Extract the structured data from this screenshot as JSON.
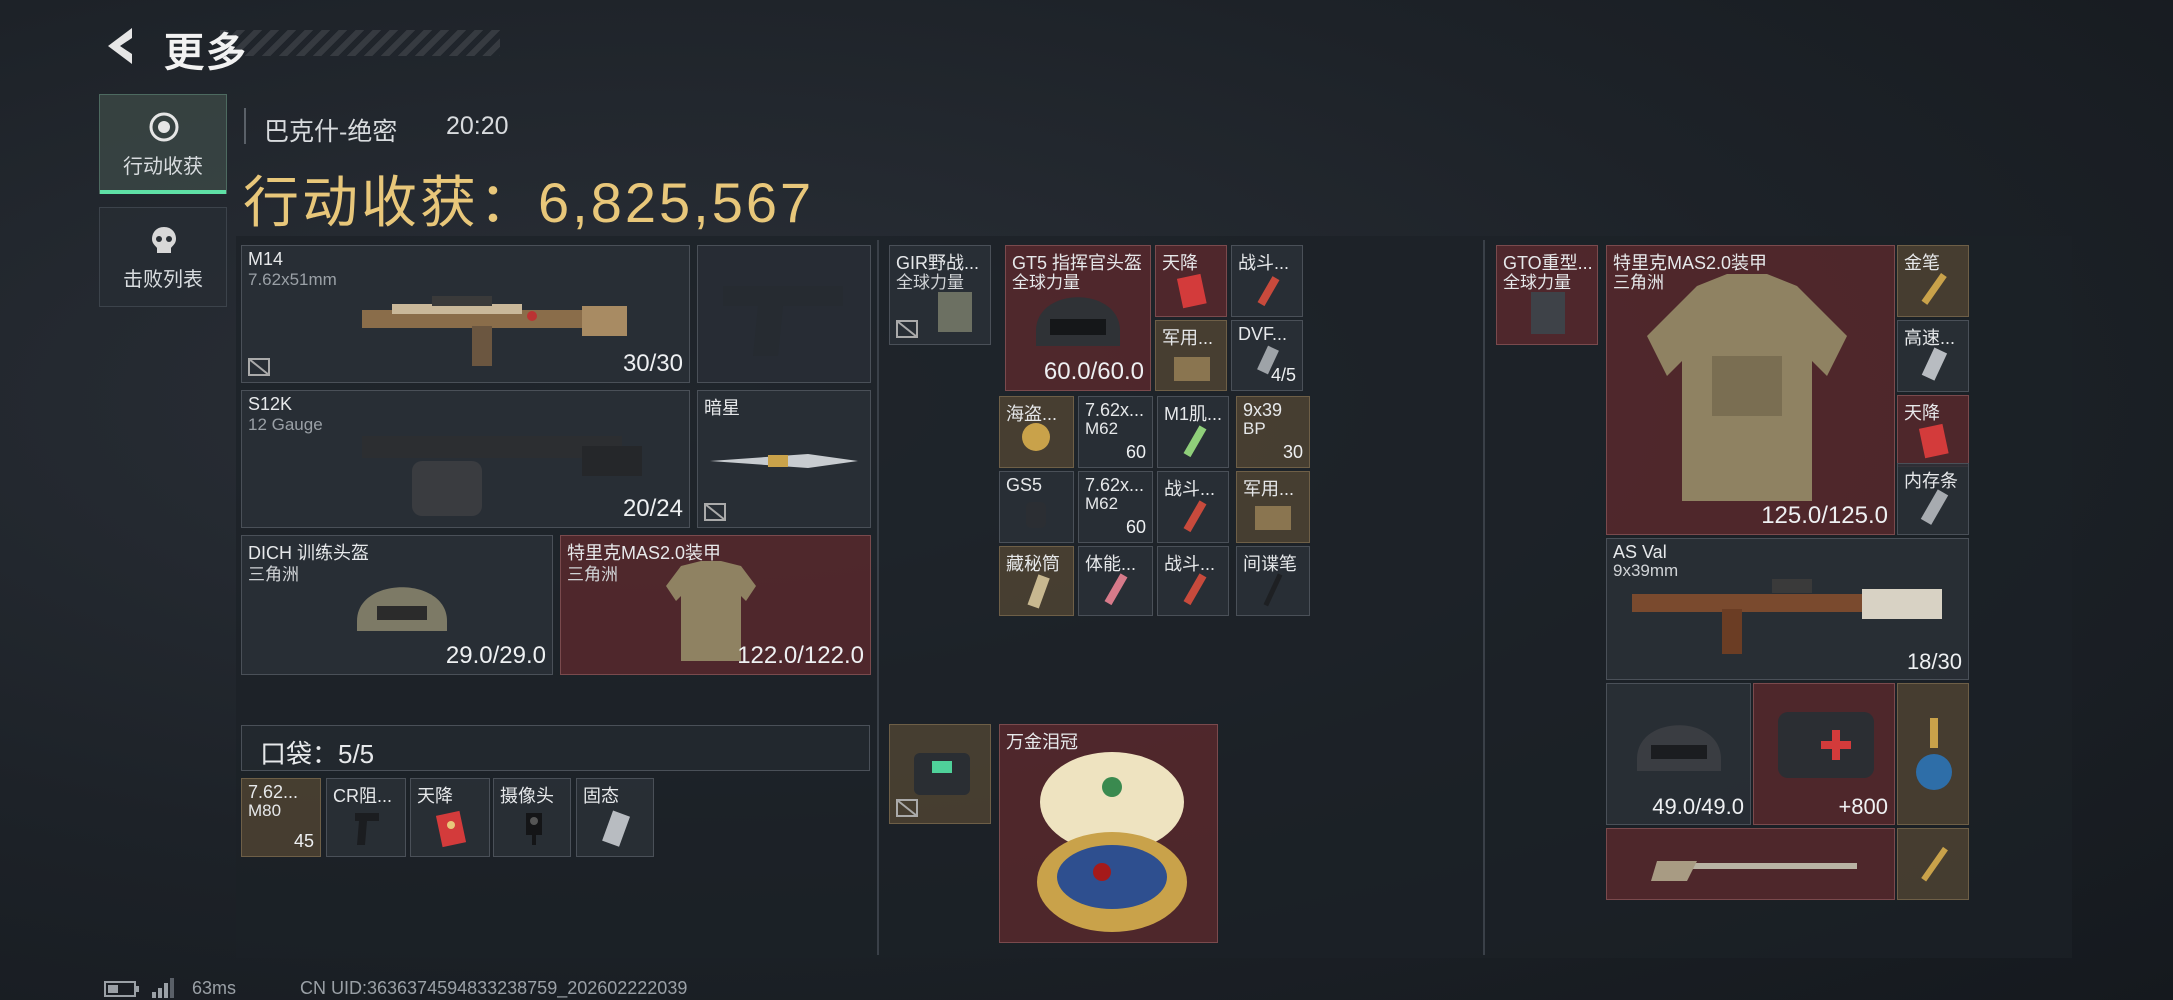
{
  "header": {
    "title": "更多"
  },
  "tabs": [
    {
      "label": "行动收获",
      "active": true
    },
    {
      "label": "击败列表",
      "active": false
    }
  ],
  "operation": {
    "map": "巴克什-绝密",
    "time": "20:20",
    "loot_label": "行动收获：6,825,567"
  },
  "loadout": {
    "primary": {
      "name": "M14",
      "caliber": "7.62x51mm",
      "ammo": "30/30"
    },
    "secondary": {
      "name": "S12K",
      "caliber": "12 Gauge",
      "ammo": "20/24"
    },
    "melee": {
      "name": "暗星"
    },
    "helmet": {
      "name": "DICH 训练头盔",
      "origin": "三角洲",
      "durability": "29.0/29.0"
    },
    "armor": {
      "name": "特里克MAS2.0装甲",
      "origin": "三角洲",
      "durability": "122.0/122.0"
    },
    "pocket": {
      "label": "口袋：5/5",
      "items": [
        {
          "name": "7.62...",
          "sub": "M80",
          "count": "45"
        },
        {
          "name": "CR阻..."
        },
        {
          "name": "天降"
        },
        {
          "name": "摄像头"
        },
        {
          "name": "固态"
        }
      ]
    }
  },
  "middle": {
    "rig": {
      "name": "GIR野战...",
      "origin": "全球力量"
    },
    "helmet": {
      "name": "GT5 指挥官头盔",
      "origin": "全球力量",
      "durability": "60.0/60.0"
    },
    "rig_items": [
      {
        "name": "天降"
      },
      {
        "name": "战斗..."
      },
      {
        "name": "军用..."
      },
      {
        "name": "DVF...",
        "count": "4/5"
      }
    ],
    "backpack_items": [
      {
        "name": "海盗..."
      },
      {
        "name": "7.62x...",
        "sub": "M62",
        "count": "60"
      },
      {
        "name": "M1肌..."
      },
      {
        "name": "9x39",
        "sub": "BP",
        "count": "30"
      },
      {
        "name": "GS5"
      },
      {
        "name": "7.62x...",
        "sub": "M62",
        "count": "60"
      },
      {
        "name": "战斗..."
      },
      {
        "name": "军用..."
      },
      {
        "name": "藏秘筒"
      },
      {
        "name": "体能..."
      },
      {
        "name": "战斗..."
      },
      {
        "name": "间谍笔"
      }
    ],
    "safe_box": {
      "name": ""
    },
    "treasure": {
      "name": "万金泪冠"
    }
  },
  "right": {
    "rig": {
      "name": "GTO重型...",
      "origin": "全球力量"
    },
    "armor": {
      "name": "特里克MAS2.0装甲",
      "origin": "三角洲",
      "durability": "125.0/125.0"
    },
    "armor_side": [
      {
        "name": "金笔"
      },
      {
        "name": "高速..."
      },
      {
        "name": "天降"
      },
      {
        "name": "内存条"
      }
    ],
    "weapon": {
      "name": "AS Val",
      "caliber": "9x39mm",
      "ammo": "18/30"
    },
    "helmet_val": "49.0/49.0",
    "medkit_val": "+800"
  },
  "status": {
    "ping": "63ms",
    "uid": "CN UID:3636374594833238759_202602222039"
  },
  "colors": {
    "accent": "#5fe0a6",
    "gold": "#e8c77a"
  }
}
